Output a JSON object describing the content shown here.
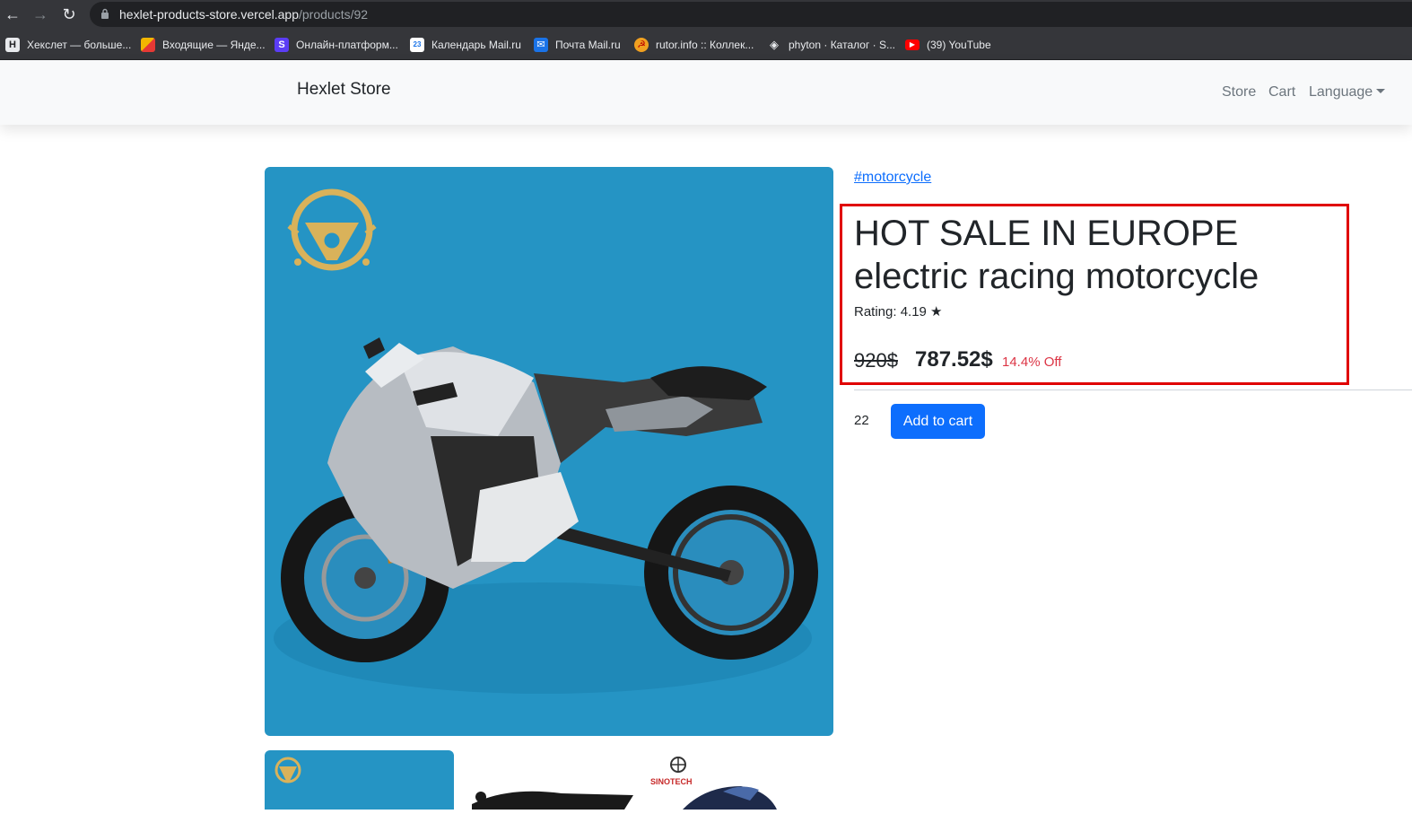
{
  "browser": {
    "url_host": "hexlet-products-store.vercel.app",
    "url_path": "/products/92",
    "bookmarks": [
      {
        "label": "Хекслет — больше...",
        "icon": "hexlet-favicon"
      },
      {
        "label": "Входящие — Янде...",
        "icon": "yandex-mail-favicon"
      },
      {
        "label": "Онлайн-платформ...",
        "icon": "skillbox-favicon"
      },
      {
        "label": "Календарь Mail.ru",
        "icon": "calendar-favicon"
      },
      {
        "label": "Почта Mail.ru",
        "icon": "mail-favicon"
      },
      {
        "label": "rutor.info :: Коллек...",
        "icon": "rutor-favicon"
      },
      {
        "label": "phyton · Каталог · S...",
        "icon": "catalog-favicon"
      },
      {
        "label": "(39) YouTube",
        "icon": "youtube-favicon"
      }
    ]
  },
  "navbar": {
    "brand": "Hexlet Store",
    "links": {
      "store": "Store",
      "cart": "Cart",
      "language": "Language"
    }
  },
  "product": {
    "tag": "#motorcycle",
    "title": "HOT SALE IN EUROPE electric racing motorcycle",
    "rating": "Rating: 4.19 ★",
    "old_price": "920$",
    "new_price": "787.52$",
    "discount": "14.4% Off",
    "stock": "22",
    "add_to_cart": "Add to cart",
    "thumb_brand": "SINOTECH"
  },
  "colors": {
    "image_bg": "#2594c4",
    "accent": "#0d6efd",
    "discount": "#dc3545",
    "highlight": "#e00000"
  }
}
